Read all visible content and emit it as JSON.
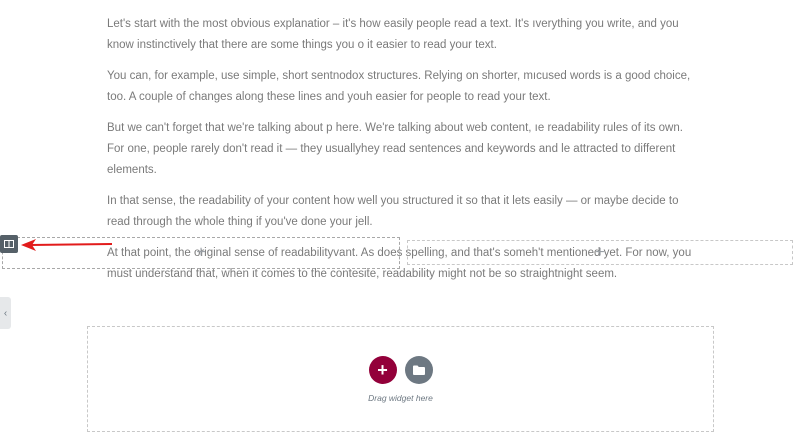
{
  "paragraphs": [
    "Let's start with the most obvious explanatior – it's how easily people read a text. It's ıverything you write, and you know instinctively that there are some things you ο it easier to read your text.",
    "You can, for example, use simple, short sentnodox structures. Relying on shorter, mıcused words is a good choice, too. A couple of changes along these lines and youh easier for people to read your text.",
    "But we can't forget that we're talking about p here. We're talking about web content, ıe readability rules of its own. For one, people rarely don't read it — they usuallyhey read sentences and keywords and lе attracted to different elements.",
    "In that sense, the readability of your content how well you structured it so that it lets  easily — or maybe decide to read through the whole thing if you've done your jell.",
    "At that point, the original sense of readabilityvant. As does spelling, and that's someh't mentioned yet. For now, you must understand that, when it comes to the contesite, readability might not be so straightnight seem."
  ],
  "columns": {
    "left_add": "+",
    "right_add": "+"
  },
  "dropzone": {
    "add_label": "+",
    "hint": "Drag widget here"
  },
  "side_toggle": "‹",
  "icons": {
    "column_handle": "columns-icon",
    "library": "folder-icon",
    "arrow": "arrow-left-icon"
  },
  "colors": {
    "accent": "#93003a",
    "handle": "#556068",
    "arrow": "#e21b1b",
    "library": "#6d7882"
  }
}
